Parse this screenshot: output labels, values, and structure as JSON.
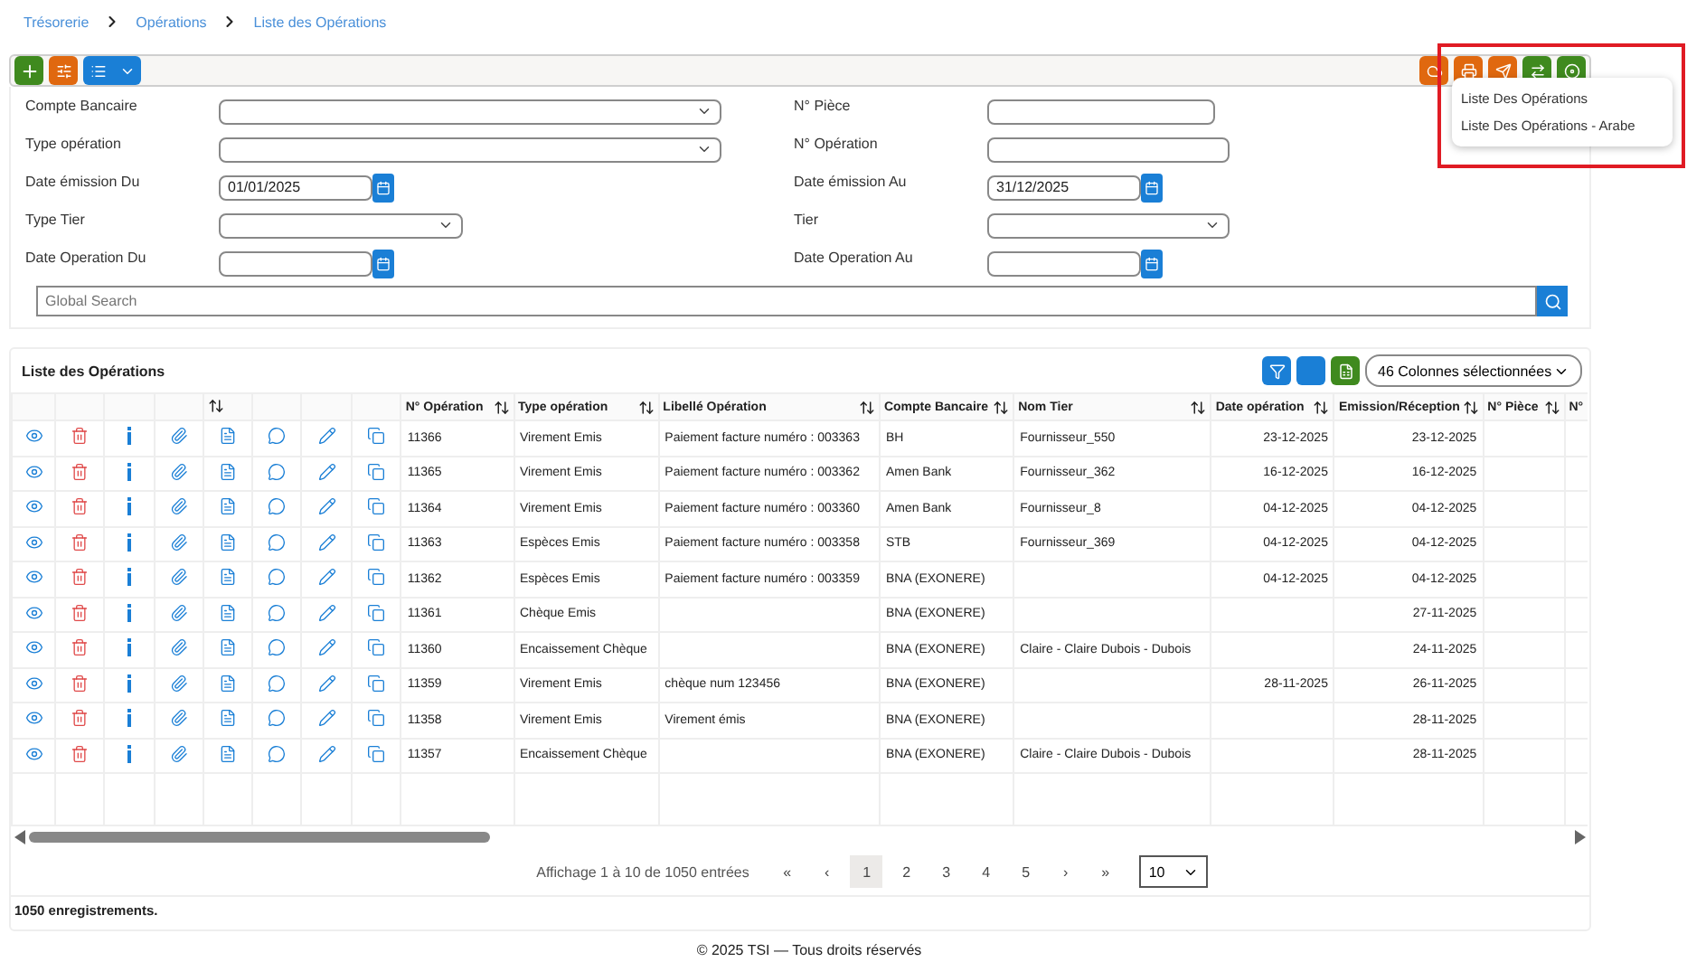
{
  "breadcrumb": [
    "Trésorerie",
    "Opérations",
    "Liste des Opérations"
  ],
  "filters": [
    {
      "label": "Compte Bancaire",
      "kind": "select"
    },
    {
      "label": "N° Pièce",
      "kind": "text"
    },
    {
      "label": "Type opération",
      "kind": "select"
    },
    {
      "label": "N° Opération",
      "kind": "text"
    },
    {
      "label": "Date émission Du",
      "kind": "date",
      "value": "01/01/2025"
    },
    {
      "label": "Date émission Au",
      "kind": "date",
      "value": "31/12/2025"
    },
    {
      "label": "Type Tier",
      "kind": "select"
    },
    {
      "label": "Tier",
      "kind": "select"
    },
    {
      "label": "Date Operation Du",
      "kind": "date"
    },
    {
      "label": "Date Operation Au",
      "kind": "date"
    }
  ],
  "search": {
    "placeholder": "Global Search"
  },
  "export_menu": {
    "expanded": true,
    "items": [
      "Liste Des Opérations",
      "Liste Des Opérations - Arabe"
    ]
  },
  "table": {
    "title": "Liste des Opérations",
    "columns_selector": "46 Colonnes sélectionnées",
    "columns": [
      {
        "label": "N° Opération",
        "kind": "text"
      },
      {
        "label": "Type opération",
        "kind": "text"
      },
      {
        "label": "Libellé Opération",
        "kind": "text"
      },
      {
        "label": "Compte Bancaire",
        "kind": "text"
      },
      {
        "label": "Nom Tier",
        "kind": "text"
      },
      {
        "label": "Date opération",
        "kind": "date"
      },
      {
        "label": "Emission/Réception",
        "kind": "date"
      },
      {
        "label": "N° Pièce",
        "kind": "text"
      },
      {
        "label": "N°",
        "kind": "text"
      }
    ],
    "rows": [
      [
        "11366",
        "Virement Emis",
        "Paiement facture numéro : 003363",
        "BH",
        "Fournisseur_550",
        "23-12-2025",
        "23-12-2025",
        "",
        ""
      ],
      [
        "11365",
        "Virement Emis",
        "Paiement facture numéro : 003362",
        "Amen Bank",
        "Fournisseur_362",
        "16-12-2025",
        "16-12-2025",
        "",
        ""
      ],
      [
        "11364",
        "Virement Emis",
        "Paiement facture numéro : 003360",
        "Amen Bank",
        "Fournisseur_8",
        "04-12-2025",
        "04-12-2025",
        "",
        ""
      ],
      [
        "11363",
        "Espèces Emis",
        "Paiement facture numéro : 003358",
        "STB",
        "Fournisseur_369",
        "04-12-2025",
        "04-12-2025",
        "",
        ""
      ],
      [
        "11362",
        "Espèces Emis",
        "Paiement facture numéro : 003359",
        "BNA (EXONERE)",
        "",
        "04-12-2025",
        "04-12-2025",
        "",
        ""
      ],
      [
        "11361",
        "Chèque Emis",
        "",
        "BNA (EXONERE)",
        "",
        "",
        "27-11-2025",
        "",
        ""
      ],
      [
        "11360",
        "Encaissement Chèque",
        "",
        "BNA (EXONERE)",
        "Claire - Claire Dubois - Dubois",
        "",
        "24-11-2025",
        "",
        ""
      ],
      [
        "11359",
        "Virement Emis",
        "chèque num 123456",
        "BNA (EXONERE)",
        "",
        "28-11-2025",
        "26-11-2025",
        "",
        ""
      ],
      [
        "11358",
        "Virement Emis",
        "Virement émis",
        "BNA (EXONERE)",
        "",
        "",
        "28-11-2025",
        "",
        ""
      ],
      [
        "11357",
        "Encaissement Chèque",
        "",
        "BNA (EXONERE)",
        "Claire - Claire Dubois - Dubois",
        "",
        "28-11-2025",
        "",
        ""
      ]
    ]
  },
  "pagination": {
    "summary": "Affichage 1 à 10 de 1050 entrées",
    "first": "«",
    "prev": "‹",
    "next": "›",
    "last": "»",
    "pages": [
      {
        "label": "1",
        "selected": true
      },
      {
        "label": "2",
        "selected": false
      },
      {
        "label": "3",
        "selected": false
      },
      {
        "label": "4",
        "selected": false
      },
      {
        "label": "5",
        "selected": false
      }
    ],
    "page_size": "10"
  },
  "record_count": "1050 enregistrements.",
  "footer": "© 2025 TSI — Tous droits réservés"
}
